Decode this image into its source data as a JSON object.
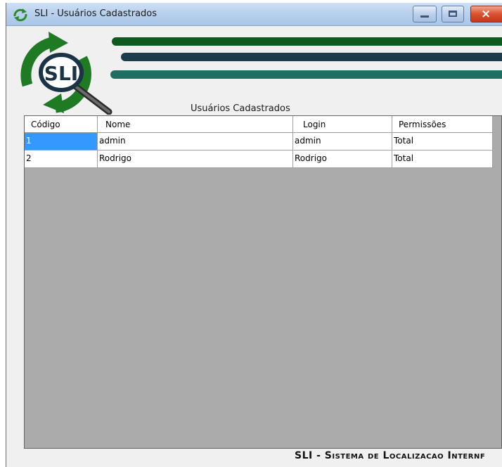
{
  "window": {
    "title": "SLI - Usuários Cadastrados",
    "controls": {
      "minimize": "minimize",
      "maximize": "maximize",
      "close": "×"
    }
  },
  "logo": {
    "text": "SLI"
  },
  "grid": {
    "caption": "Usuários Cadastrados",
    "columns": [
      "Código",
      "Nome",
      "Login",
      "Permissões"
    ],
    "rows": [
      {
        "codigo": "1",
        "nome": "admin",
        "login": "admin",
        "permissoes": "Total",
        "selected": true
      },
      {
        "codigo": "2",
        "nome": "Rodrigo",
        "login": "Rodrigo",
        "permissoes": "Total",
        "selected": false
      }
    ]
  },
  "status_bar": {
    "text": "SLI - Sistema de Localizacao Internf"
  },
  "colors": {
    "stripe_top": "#0f5a1e",
    "stripe_middle": "#1d3d4d",
    "stripe_bottom": "#1e6f62",
    "grid_background": "#ababab",
    "selection": "#3399ff"
  }
}
